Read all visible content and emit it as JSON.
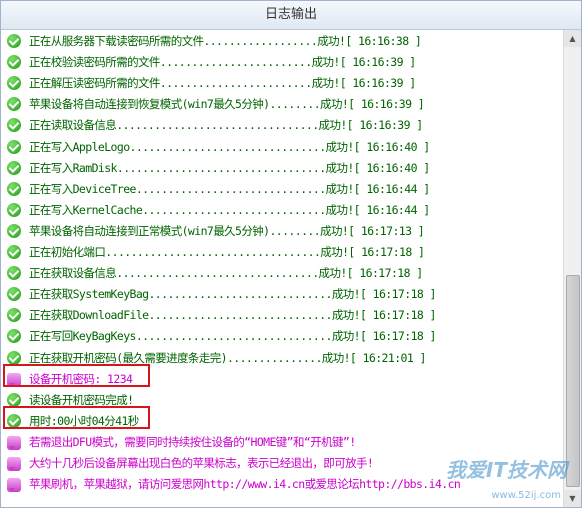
{
  "window": {
    "title": "日志输出"
  },
  "log": [
    {
      "icon": "check",
      "color": "green",
      "text": "正在从服务器下载读密码所需的文件..................成功![ 16:16:38 ]"
    },
    {
      "icon": "check",
      "color": "green",
      "text": "正在校验读密码所需的文件........................成功![ 16:16:39 ]"
    },
    {
      "icon": "check",
      "color": "green",
      "text": "正在解压读密码所需的文件........................成功![ 16:16:39 ]"
    },
    {
      "icon": "check",
      "color": "green",
      "text": "苹果设备将自动连接到恢复模式(win7最久5分钟)........成功![ 16:16:39 ]"
    },
    {
      "icon": "check",
      "color": "green",
      "text": "正在读取设备信息................................成功![ 16:16:39 ]"
    },
    {
      "icon": "check",
      "color": "green",
      "text": "正在写入AppleLogo...............................成功![ 16:16:40 ]"
    },
    {
      "icon": "check",
      "color": "green",
      "text": "正在写入RamDisk.................................成功![ 16:16:40 ]"
    },
    {
      "icon": "check",
      "color": "green",
      "text": "正在写入DeviceTree..............................成功![ 16:16:44 ]"
    },
    {
      "icon": "check",
      "color": "green",
      "text": "正在写入KernelCache.............................成功![ 16:16:44 ]"
    },
    {
      "icon": "check",
      "color": "green",
      "text": "苹果设备将自动连接到正常模式(win7最久5分钟)........成功![ 16:17:13 ]"
    },
    {
      "icon": "check",
      "color": "green",
      "text": "正在初始化端口..................................成功![ 16:17:18 ]"
    },
    {
      "icon": "check",
      "color": "green",
      "text": "正在获取设备信息................................成功![ 16:17:18 ]"
    },
    {
      "icon": "check",
      "color": "green",
      "text": "正在获取SystemKeyBag.............................成功![ 16:17:18 ]"
    },
    {
      "icon": "check",
      "color": "green",
      "text": "正在获取DownloadFile.............................成功![ 16:17:18 ]"
    },
    {
      "icon": "check",
      "color": "green",
      "text": "正在写回KeyBagKeys...............................成功![ 16:17:18 ]"
    },
    {
      "icon": "check",
      "color": "green",
      "text": "正在获取开机密码(最久需要进度条走完)...............成功![ 16:21:01 ]"
    },
    {
      "icon": "bubble",
      "color": "magenta",
      "text": "设备开机密码: 1234"
    },
    {
      "icon": "check",
      "color": "green",
      "text": "读设备开机密码完成!"
    },
    {
      "icon": "check",
      "color": "green",
      "text": "用时:00小时04分41秒"
    },
    {
      "icon": "bubble",
      "color": "magenta",
      "text": "若需退出DFU模式，需要同时持续按住设备的“HOME键”和“开机键”!"
    },
    {
      "icon": "bubble",
      "color": "magenta",
      "text": "大约十几秒后设备屏幕出现白色的苹果标志，表示已经退出，即可放手!"
    },
    {
      "icon": "bubble",
      "color": "magenta",
      "text": "苹果刷机，苹果越狱，请访问爱思网http://www.i4.cn或爱思论坛http://bbs.i4.cn"
    }
  ],
  "watermark": {
    "brand": "我爱IT技术网",
    "url": "www.52ij.com"
  },
  "colors": {
    "green_text": "#006400",
    "magenta_text": "#cc00cc",
    "highlight": "#d8141d"
  }
}
